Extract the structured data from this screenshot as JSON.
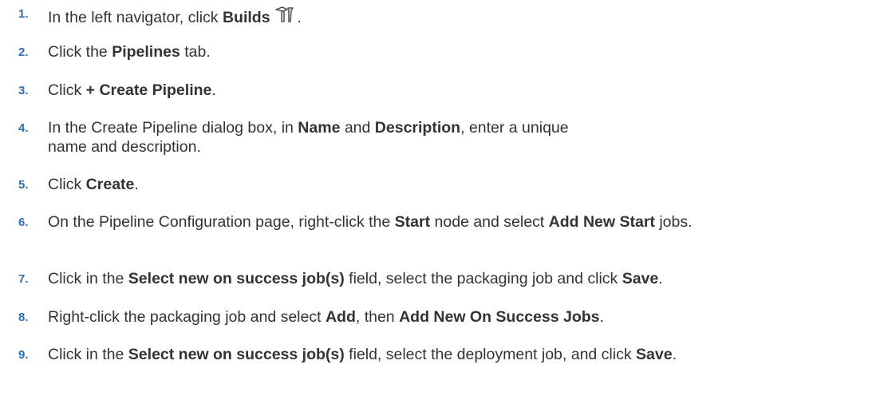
{
  "steps": [
    {
      "num": "1.",
      "parts": [
        {
          "t": "In the left navigator, click "
        },
        {
          "t": "Builds",
          "b": true
        },
        {
          "icon": "hammer-icon"
        },
        {
          "t": "."
        }
      ]
    },
    {
      "num": "2.",
      "parts": [
        {
          "t": "Click the "
        },
        {
          "t": "Pipelines",
          "b": true
        },
        {
          "t": " tab."
        }
      ]
    },
    {
      "num": "3.",
      "parts": [
        {
          "t": "Click "
        },
        {
          "t": "+ Create Pipeline",
          "b": true
        },
        {
          "t": "."
        }
      ]
    },
    {
      "num": "4.",
      "parts": [
        {
          "t": "In the Create Pipeline dialog box, in "
        },
        {
          "t": "Name",
          "b": true
        },
        {
          "t": " and "
        },
        {
          "t": "Description",
          "b": true
        },
        {
          "t": ", enter a unique name and description."
        }
      ]
    },
    {
      "num": "5.",
      "parts": [
        {
          "t": "Click "
        },
        {
          "t": "Create",
          "b": true
        },
        {
          "t": "."
        }
      ]
    },
    {
      "num": "6.",
      "parts": [
        {
          "t": "On the Pipeline Configuration page, right-click the "
        },
        {
          "t": "Start",
          "b": true
        },
        {
          "t": " node and select "
        },
        {
          "t": "Add New Start",
          "b": true
        },
        {
          "t": " jobs."
        }
      ]
    },
    {
      "num": "7.",
      "parts": [
        {
          "t": "Click in the "
        },
        {
          "t": "Select new on success job(s)",
          "b": true
        },
        {
          "t": " field, select the packaging job and click "
        },
        {
          "t": "Save",
          "b": true
        },
        {
          "t": "."
        }
      ]
    },
    {
      "num": "8.",
      "parts": [
        {
          "t": "Right-click the packaging job and select "
        },
        {
          "t": "Add",
          "b": true
        },
        {
          "t": ", then "
        },
        {
          "t": "Add New On Success Jobs",
          "b": true
        },
        {
          "t": "."
        }
      ]
    },
    {
      "num": "9.",
      "parts": [
        {
          "t": "Click in the "
        },
        {
          "t": "Select new on success job(s)",
          "b": true
        },
        {
          "t": " field, select the deployment job, and click "
        },
        {
          "t": "Save",
          "b": true
        },
        {
          "t": "."
        }
      ]
    }
  ]
}
